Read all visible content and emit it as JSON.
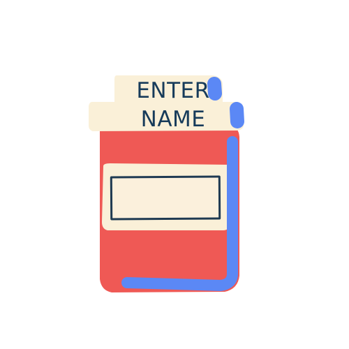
{
  "lid": {
    "line1": "ENTER",
    "line2": "NAME"
  },
  "label": {
    "value": ""
  },
  "colors": {
    "jar_body": "#ef5955",
    "lid": "#faf0d8",
    "label_band": "#faf0d8",
    "highlight": "#5b88f5",
    "ink": "#173b5a"
  },
  "icons": {
    "jar": "jar-icon"
  }
}
